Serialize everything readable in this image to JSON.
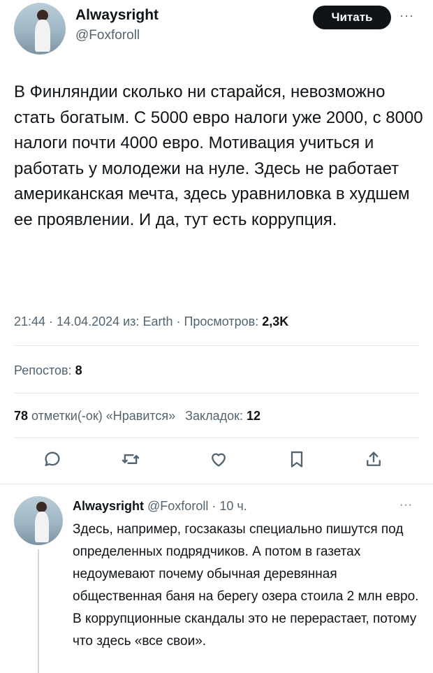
{
  "main_tweet": {
    "name": "Alwaysright",
    "handle": "@Foxforoll",
    "follow_label": "Читать",
    "more": "···",
    "text": "В Финляндии сколько ни старайся, невозможно стать богатым. С 5000 евро налоги уже 2000, с 8000 налоги почти 4000 евро. Мотивация учиться и работать у молодежи на нуле. Здесь не работает американская мечта, здесь уравниловка в худшем ее проявлении. И да, тут есть коррупция.",
    "meta_prefix": "21:44 · 14.04.2024 из: Earth · Просмотров: ",
    "views": "2,3K",
    "reposts_label": "Репостов: ",
    "reposts": "8",
    "likes": "78",
    "likes_label": " отметки(-ок) «Нравится»",
    "bookmarks_label": "Закладок: ",
    "bookmarks": "12",
    "actions": [
      "reply-icon",
      "retweet-icon",
      "like-icon",
      "bookmark-icon",
      "share-icon"
    ]
  },
  "reply": {
    "name": "Alwaysright",
    "handle_time": " @Foxforoll · 10 ч.",
    "more": "···",
    "text": "Здесь, например, госзаказы специально пишутся под определенных подрядчиков. А потом в газетах недоумевают почему обычная деревянная общественная баня на берегу озера стоила 2 млн евро. В коррупционные скандалы это не перерастает, потому что здесь «все свои»."
  },
  "colors": {
    "text": "#0f1419",
    "secondary": "#536471",
    "divider": "#e3e7ea",
    "button": "#0f1419"
  }
}
